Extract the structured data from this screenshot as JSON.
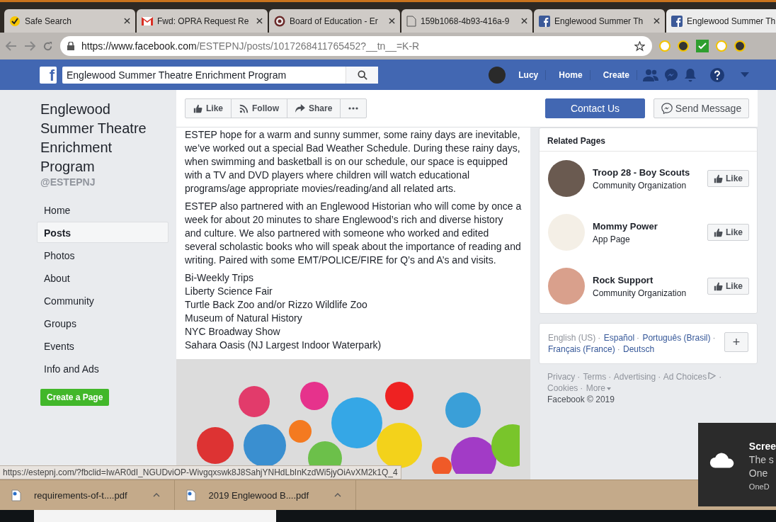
{
  "browser": {
    "tabs": [
      {
        "title": "Safe Search",
        "selected": false
      },
      {
        "title": "Fwd: OPRA Request Re",
        "selected": false
      },
      {
        "title": "Board of Education - Er",
        "selected": false
      },
      {
        "title": "159b1068-4b93-416a-9",
        "selected": false
      },
      {
        "title": "Englewood Summer Th",
        "selected": false
      },
      {
        "title": "Englewood Summer Th",
        "selected": true
      }
    ],
    "url": {
      "origin": "https://www.facebook.com",
      "path": "/ESTEPNJ/posts/1017268411765452?__tn__=K-R"
    }
  },
  "facebook_bar": {
    "logo": "f",
    "search_value": "Englewood Summer Theatre Enrichment Program",
    "user": "Lucy",
    "links": [
      "Home",
      "Create"
    ]
  },
  "sidebar": {
    "page_title": "Englewood Summer Theatre Enrichment Program",
    "handle": "@ESTEPNJ",
    "items": [
      {
        "label": "Home",
        "selected": false
      },
      {
        "label": "Posts",
        "selected": true
      },
      {
        "label": "Photos",
        "selected": false
      },
      {
        "label": "About",
        "selected": false
      },
      {
        "label": "Community",
        "selected": false
      },
      {
        "label": "Groups",
        "selected": false
      },
      {
        "label": "Events",
        "selected": false
      },
      {
        "label": "Info and Ads",
        "selected": false
      }
    ],
    "create_button": "Create a Page"
  },
  "page_actions": {
    "buttons": [
      {
        "label": "Like",
        "kind": "like"
      },
      {
        "label": "Follow",
        "kind": "follow"
      },
      {
        "label": "Share",
        "kind": "share"
      },
      {
        "kind": "more"
      }
    ],
    "contact": "Contact Us",
    "message": "Send Message"
  },
  "post": {
    "paragraphs": [
      "ESTEP hope for a warm and sunny summer, some rainy days are inevitable, we’ve worked out a special Bad Weather Schedule. During these rainy days, when swimming and basketball is on our schedule, our space is equipped with a TV and DVD players where children will watch educational programs/age appropriate movies/reading/and all related arts.",
      "ESTEP also partnered with an Englewood Historian who will come by once a week for about 20 minutes to share Englewood’s rich and diverse history and culture. We also partnered with someone who worked and edited several scholastic books who will speak about the importance of reading and writing. Paired with some EMT/POLICE/FIRE for Q’s and A’s and visits."
    ],
    "list": [
      "Bi-Weekly Trips",
      "Liberty Science Fair",
      "Turtle Back Zoo and/or Rizzo Wildlife Zoo",
      "Museum of Natural History",
      "NYC Broadway Show",
      "Sahara Oasis (NJ Largest Indoor Waterpark)"
    ]
  },
  "related_pages": {
    "title": "Related Pages",
    "items": [
      {
        "name": "Troop 28 - Boy Scouts",
        "category": "Community Organization",
        "like": "Like",
        "color": "#6a5a50"
      },
      {
        "name": "Mommy Power",
        "category": "App Page",
        "like": "Like",
        "color": "#f4efe6"
      },
      {
        "name": "Rock Support",
        "category": "Community Organization",
        "like": "Like",
        "color": "#d9a08c"
      }
    ]
  },
  "languages": {
    "separator": "·",
    "items": [
      {
        "label": "English (US)",
        "selected": true
      },
      {
        "label": "Español",
        "selected": false
      },
      {
        "label": "Português (Brasil)",
        "selected": false
      },
      {
        "label": "Français (France)",
        "selected": false
      },
      {
        "label": "Deutsch",
        "selected": false
      }
    ],
    "more": "+"
  },
  "footer": {
    "links": [
      {
        "label": "Privacy",
        "kind": "plain"
      },
      {
        "label": "Terms",
        "kind": "plain"
      },
      {
        "label": "Advertising",
        "kind": "plain"
      },
      {
        "label": "Ad Choices",
        "kind": "adchoices"
      },
      {
        "label": "Cookies",
        "kind": "plain"
      },
      {
        "label": "More",
        "kind": "more"
      }
    ],
    "copyright": "Facebook © 2019"
  },
  "status_url": "https://estepnj.com/?fbclid=IwAR0dI_NGUDviOP-Wivgqxswk8J8SahjYNHdLbInKzdWi5jyOiAvXM2k1Q_4",
  "downloads": [
    {
      "name": "requirements-of-t....pdf"
    },
    {
      "name": "2019 Englewood B....pdf"
    }
  ],
  "toast": {
    "title": "Scree",
    "lines": [
      "The s",
      "One"
    ],
    "source": "OneD"
  }
}
